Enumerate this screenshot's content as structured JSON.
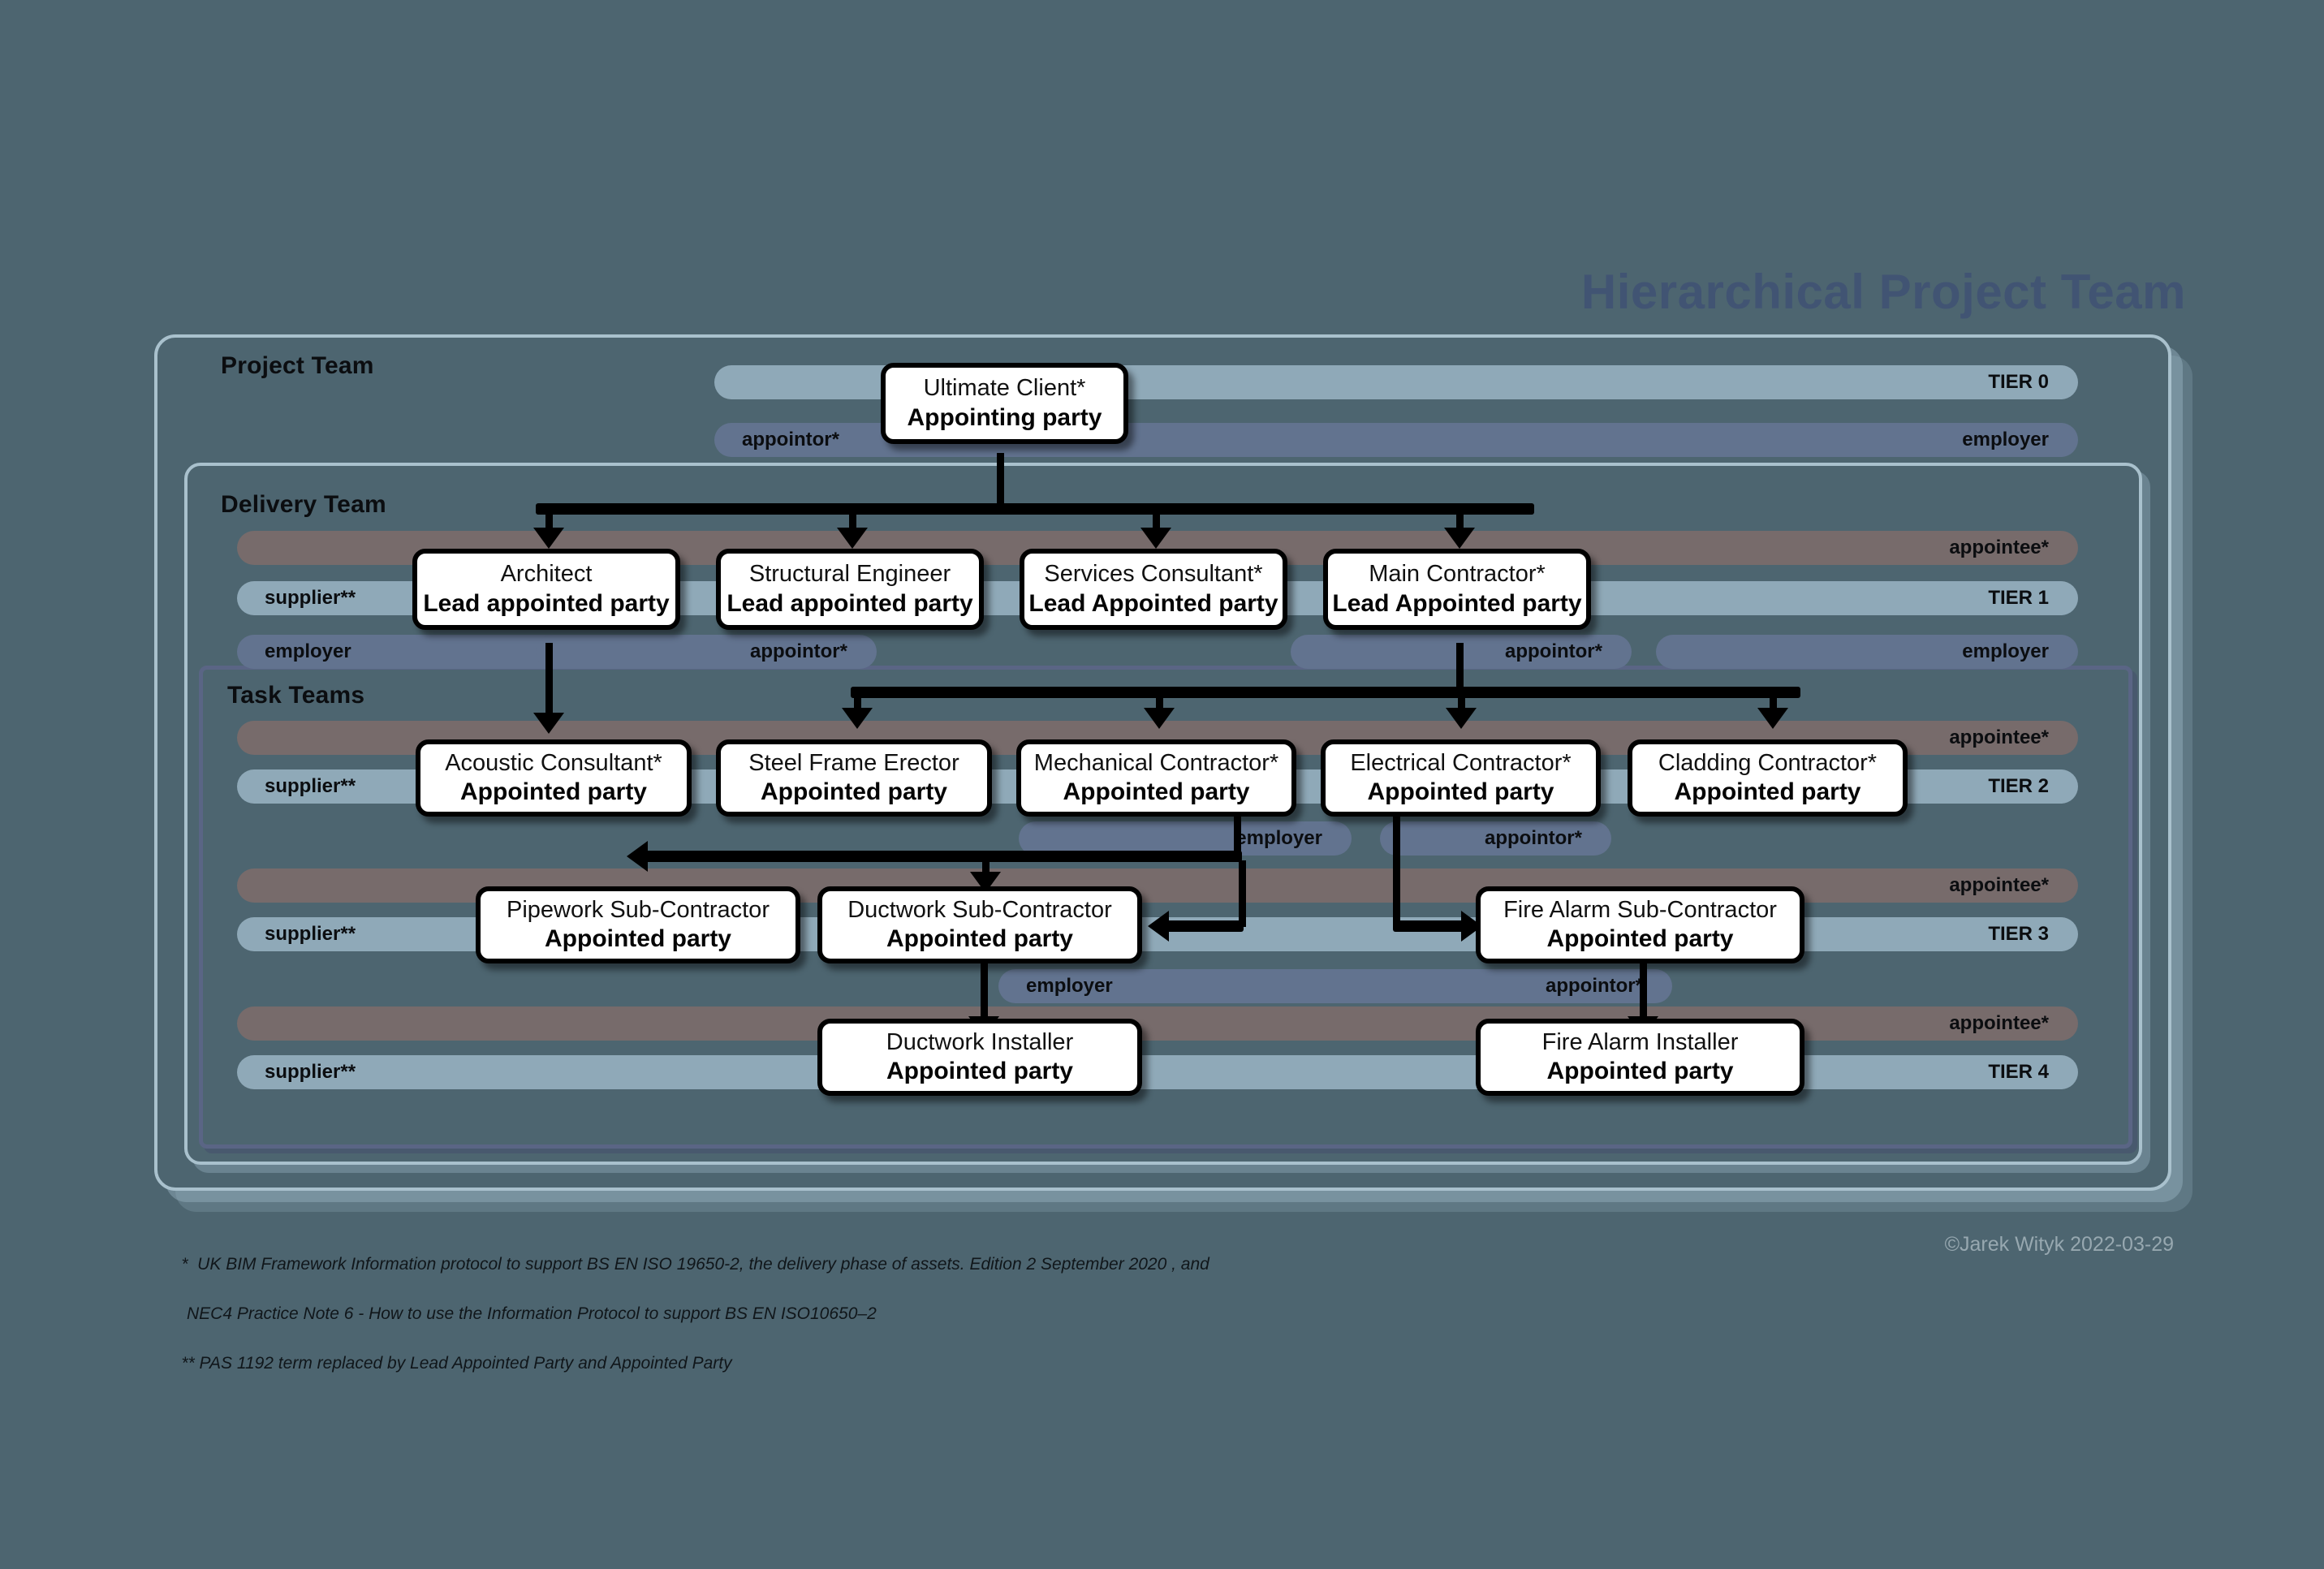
{
  "title": "Hierarchical Project Team",
  "frames": {
    "project": "Project Team",
    "delivery": "Delivery Team",
    "task": "Task Teams"
  },
  "bands": {
    "tier0": {
      "right": "TIER 0"
    },
    "row0_rel": {
      "left": "appointor*",
      "right": "employer"
    },
    "t1_appointee": {
      "right": "appointee*"
    },
    "t1_tier": {
      "left": "supplier**",
      "right": "TIER 1"
    },
    "t1_rel": {
      "left": "employer",
      "mid": "appointor*",
      "right": "employer"
    },
    "t2_appointee": {
      "right": "appointee*"
    },
    "t2_tier": {
      "left": "supplier**",
      "right": "TIER 2"
    },
    "t2_rel": {
      "left": "employer",
      "right": "appointor*"
    },
    "t3_appointee": {
      "right": "appointee*"
    },
    "t3_tier": {
      "left": "supplier**",
      "right": "TIER 3"
    },
    "t3_rel": {
      "left": "employer",
      "right": "appointor*"
    },
    "t4_appointee": {
      "right": "appointee*"
    },
    "t4_tier": {
      "left": "supplier**",
      "right": "TIER 4"
    }
  },
  "nodes": {
    "ultimate_client": {
      "role": "Ultimate Client*",
      "party": "Appointing party"
    },
    "architect": {
      "role": "Architect",
      "party": "Lead appointed party"
    },
    "structural_engineer": {
      "role": "Structural Engineer",
      "party": "Lead appointed party"
    },
    "services_consultant": {
      "role": "Services Consultant*",
      "party": "Lead Appointed party"
    },
    "main_contractor": {
      "role": "Main Contractor*",
      "party": "Lead Appointed party"
    },
    "acoustic_consultant": {
      "role": "Acoustic Consultant*",
      "party": "Appointed party"
    },
    "steel_frame_erector": {
      "role": "Steel Frame Erector",
      "party": "Appointed party"
    },
    "mechanical_contractor": {
      "role": "Mechanical Contractor*",
      "party": "Appointed party"
    },
    "electrical_contractor": {
      "role": "Electrical Contractor*",
      "party": "Appointed party"
    },
    "cladding_contractor": {
      "role": "Cladding Contractor*",
      "party": "Appointed party"
    },
    "pipework_sub": {
      "role": "Pipework Sub-Contractor",
      "party": "Appointed party"
    },
    "ductwork_sub": {
      "role": "Ductwork Sub-Contractor",
      "party": "Appointed party"
    },
    "fire_alarm_sub": {
      "role": "Fire Alarm Sub-Contractor",
      "party": "Appointed party"
    },
    "ductwork_installer": {
      "role": "Ductwork Installer",
      "party": "Appointed party"
    },
    "fire_alarm_installer": {
      "role": "Fire Alarm Installer",
      "party": "Appointed party"
    }
  },
  "footnotes": {
    "line1": "*  UK BIM Framework Information protocol to support BS EN ISO 19650-2, the delivery phase of assets. Edition 2 September 2020 , and",
    "line2": "NEC4 Practice Note 6 - How to use the Information Protocol to support BS EN ISO10650–2",
    "line3": "** PAS 1192 term replaced by Lead Appointed Party and Appointed Party"
  },
  "credit": "©Jarek Wityk 2022-03-29",
  "colors": {
    "background": "#4d6570",
    "tier_band": "#8fa9b8",
    "appointee_band": "#776b6b",
    "employer_band": "#62738f",
    "title": "#415473",
    "frame_outline": "#a9c1cd",
    "task_outline": "#5a6585"
  }
}
